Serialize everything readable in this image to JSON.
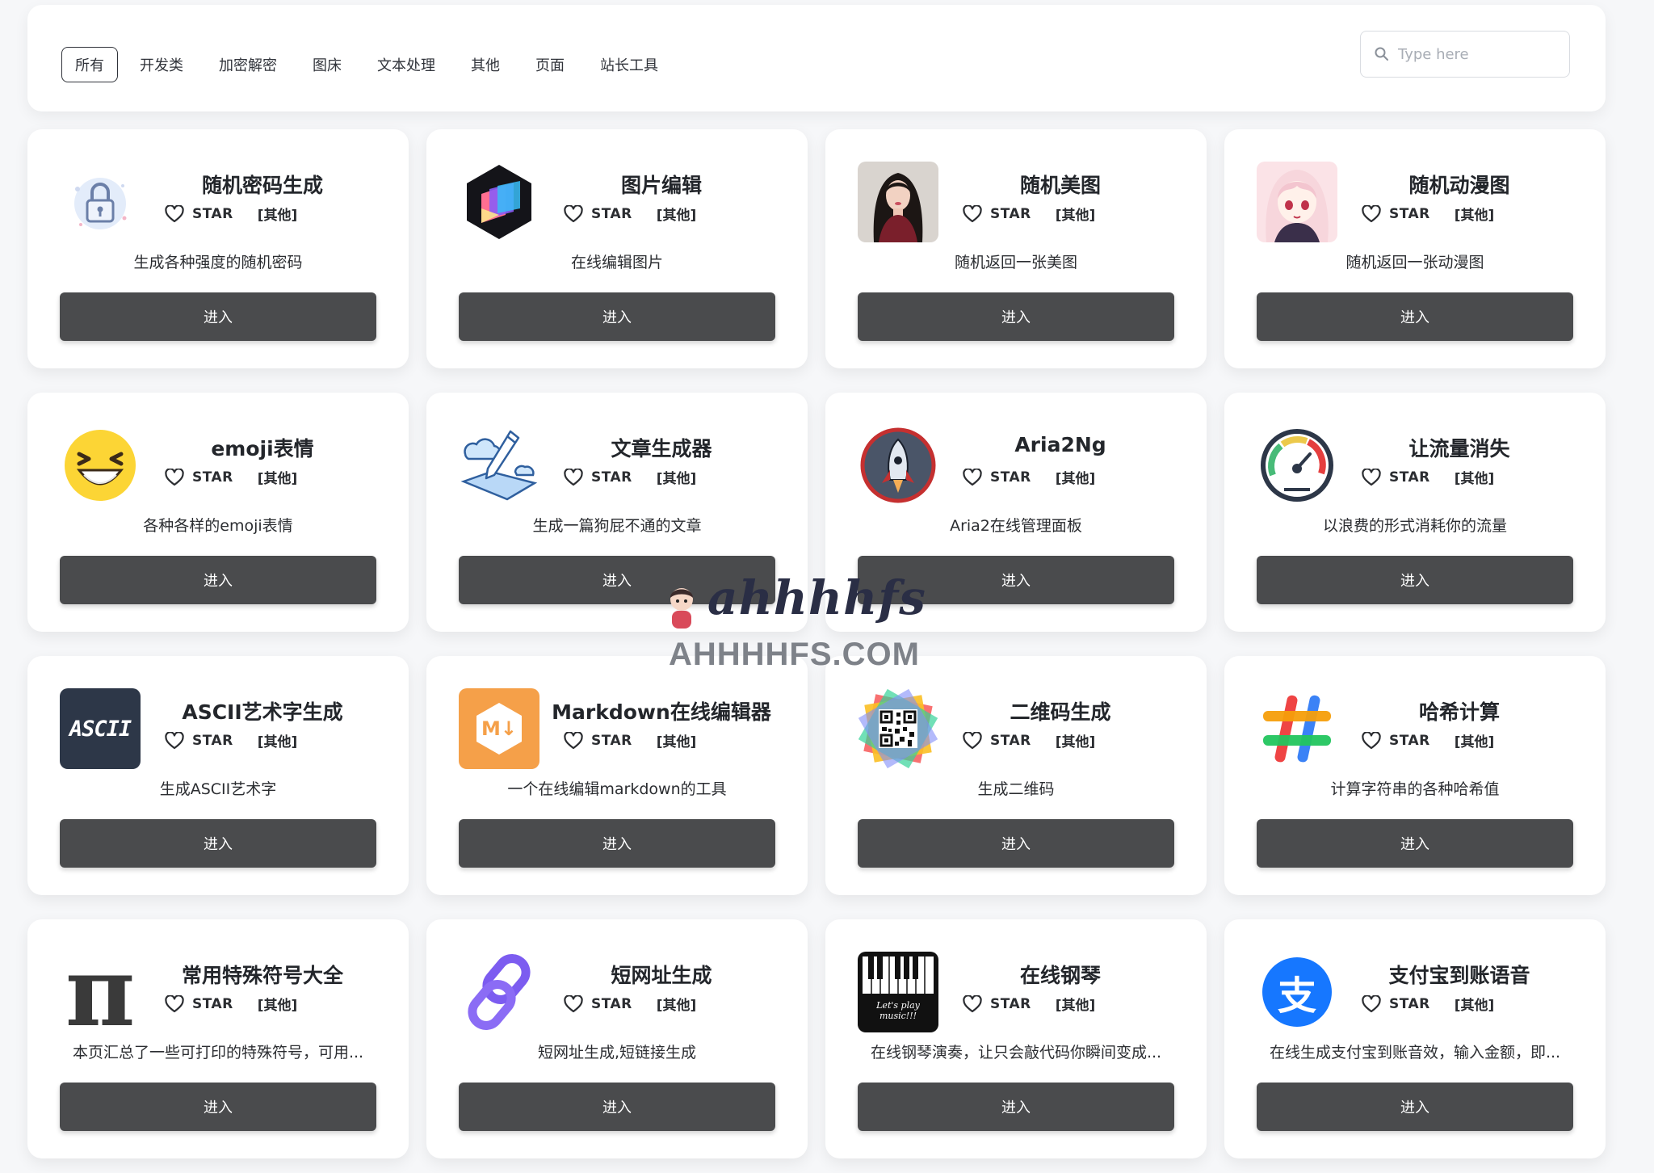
{
  "nav": {
    "tabs": [
      {
        "label": "所有",
        "active": true
      },
      {
        "label": "开发类"
      },
      {
        "label": "加密解密"
      },
      {
        "label": "图床"
      },
      {
        "label": "文本处理"
      },
      {
        "label": "其他"
      },
      {
        "label": "页面"
      },
      {
        "label": "站长工具"
      }
    ],
    "search_placeholder": "Type here"
  },
  "star_label": "STAR",
  "enter_label": "进入",
  "cards": [
    {
      "title": "随机密码生成",
      "category": "[其他]",
      "desc": "生成各种强度的随机密码",
      "icon": "lock-icon"
    },
    {
      "title": "图片编辑",
      "category": "[其他]",
      "desc": "在线编辑图片",
      "icon": "image-edit-icon"
    },
    {
      "title": "随机美图",
      "category": "[其他]",
      "desc": "随机返回一张美图",
      "icon": "portrait-photo-icon"
    },
    {
      "title": "随机动漫图",
      "category": "[其他]",
      "desc": "随机返回一张动漫图",
      "icon": "anime-portrait-icon"
    },
    {
      "title": "emoji表情",
      "category": "[其他]",
      "desc": "各种各样的emoji表情",
      "icon": "laughing-emoji-icon"
    },
    {
      "title": "文章生成器",
      "category": "[其他]",
      "desc": "生成一篇狗屁不通的文章",
      "icon": "pen-cloud-icon"
    },
    {
      "title": "Aria2Ng",
      "category": "[其他]",
      "desc": "Aria2在线管理面板",
      "icon": "rocket-icon"
    },
    {
      "title": "让流量消失",
      "category": "[其他]",
      "desc": "以浪费的形式消耗你的流量",
      "icon": "speedometer-icon"
    },
    {
      "title": "ASCII艺术字生成",
      "category": "[其他]",
      "desc": "生成ASCII艺术字",
      "icon": "ascii-icon",
      "icon_text": "ASCII"
    },
    {
      "title": "Markdown在线编辑器",
      "category": "[其他]",
      "desc": "一个在线编辑markdown的工具",
      "icon": "markdown-icon",
      "icon_text": "M↓"
    },
    {
      "title": "二维码生成",
      "category": "[其他]",
      "desc": "生成二维码",
      "icon": "qr-code-icon"
    },
    {
      "title": "哈希计算",
      "category": "[其他]",
      "desc": "计算字符串的各种哈希值",
      "icon": "hash-icon"
    },
    {
      "title": "常用特殊符号大全",
      "category": "[其他]",
      "desc": "本页汇总了一些可打印的特殊符号，可用...",
      "icon": "pi-icon",
      "icon_text": "π"
    },
    {
      "title": "短网址生成",
      "category": "[其他]",
      "desc": "短网址生成,短链接生成",
      "icon": "link-icon"
    },
    {
      "title": "在线钢琴",
      "category": "[其他]",
      "desc": "在线钢琴演奏，让只会敲代码你瞬间变成...",
      "icon": "piano-icon",
      "icon_text": "Let's play music!!!"
    },
    {
      "title": "支付宝到账语音",
      "category": "[其他]",
      "desc": "在线生成支付宝到账音效，输入金额，即...",
      "icon": "alipay-icon",
      "icon_text": "支"
    }
  ],
  "watermark": {
    "script": "ahhhhfs",
    "domain": "AHHHHFS.COM"
  }
}
